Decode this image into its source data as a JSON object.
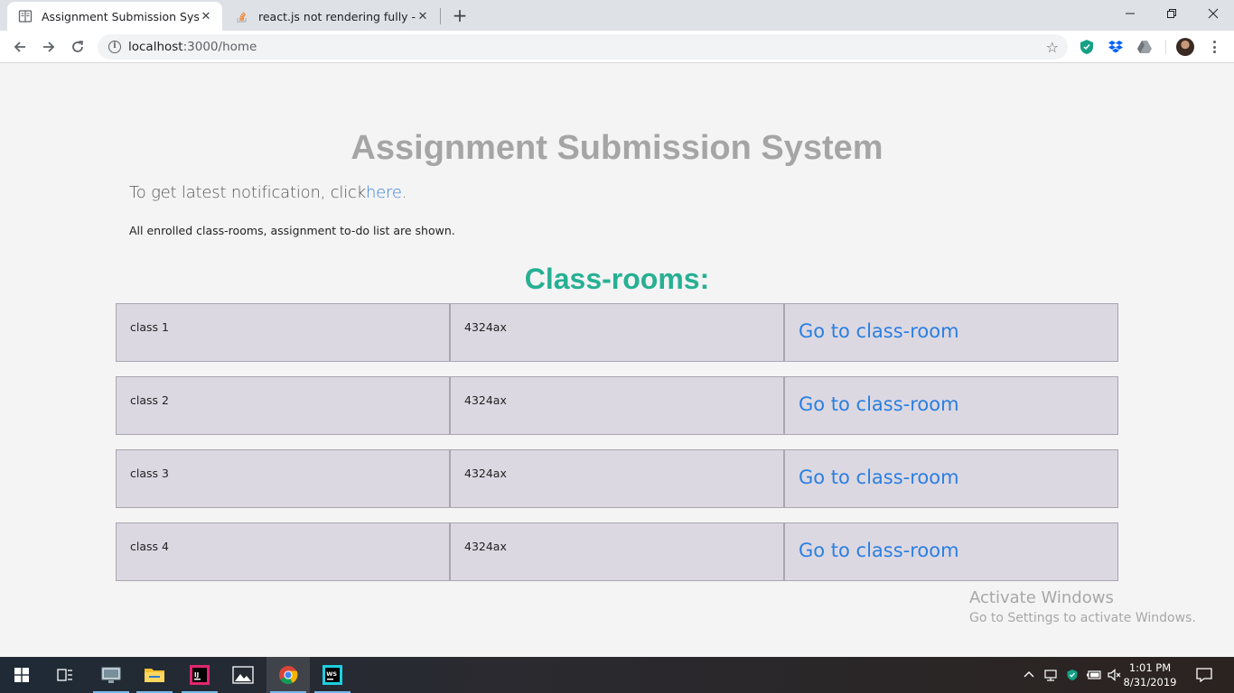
{
  "browser": {
    "tabs": [
      {
        "title": "Assignment Submission System",
        "active": true,
        "icon": "page-icon"
      },
      {
        "title": "react.js not rendering fully - Stack Overflow",
        "active": false,
        "icon": "stackoverflow-icon"
      }
    ],
    "url_host": "localhost",
    "url_path": ":3000/home",
    "new_tab_label": "+",
    "close_label": "✕",
    "minimize_label": "—",
    "restore_label": "❐",
    "window_close_label": "✕"
  },
  "page": {
    "title": "Assignment Submission System",
    "notification_prefix": "To get latest notification, click",
    "notification_link": "here",
    "notification_suffix": ".",
    "description": "All enrolled class-rooms, assignment to-do list are shown.",
    "section_title": "Class-rooms:",
    "classes": [
      {
        "name": "class 1",
        "code": "4324ax",
        "link": "Go to class-room"
      },
      {
        "name": "class 2",
        "code": "4324ax",
        "link": "Go to class-room"
      },
      {
        "name": "class 3",
        "code": "4324ax",
        "link": "Go to class-room"
      },
      {
        "name": "class 4",
        "code": "4324ax",
        "link": "Go to class-room"
      }
    ]
  },
  "watermark": {
    "line1": "Activate Windows",
    "line2": "Go to Settings to activate Windows."
  },
  "taskbar": {
    "time": "1:01 PM",
    "date": "8/31/2019"
  },
  "colors": {
    "title_gray": "#a5a5a5",
    "section_green": "#27b093",
    "link_blue": "#2a7fe0",
    "cell_bg": "#dcd8e2"
  }
}
